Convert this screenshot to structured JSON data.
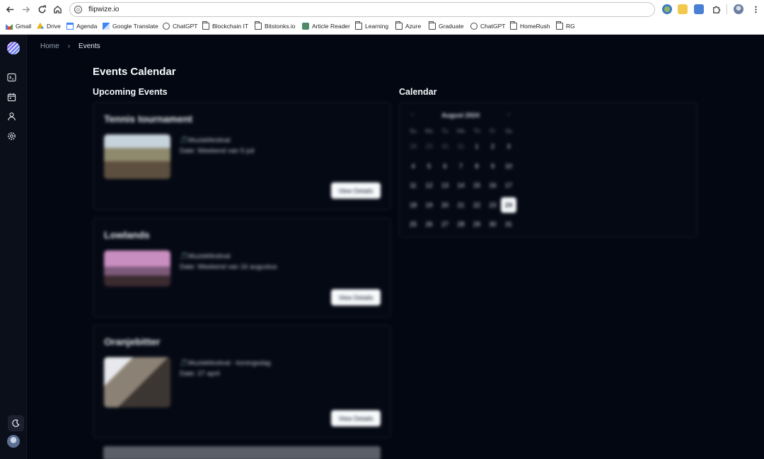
{
  "browser": {
    "url": "flipwize.io",
    "bookmarks": [
      {
        "label": "Gmail",
        "icon": "gmail-icon"
      },
      {
        "label": "Drive",
        "icon": "drive-icon"
      },
      {
        "label": "Agenda",
        "icon": "calendar-icon"
      },
      {
        "label": "Google Translate",
        "icon": "translate-icon"
      },
      {
        "label": "ChatGPT",
        "icon": "chatgpt-icon"
      },
      {
        "label": "Blockchain IT",
        "icon": "folder-icon"
      },
      {
        "label": "Bitstonks.io",
        "icon": "folder-icon"
      },
      {
        "label": "Article Reader",
        "icon": "article-reader-icon"
      },
      {
        "label": "Learning",
        "icon": "folder-icon"
      },
      {
        "label": "Azure",
        "icon": "folder-icon"
      },
      {
        "label": "Graduate",
        "icon": "folder-icon"
      },
      {
        "label": "ChatGPT",
        "icon": "chatgpt-icon"
      },
      {
        "label": "HomeRush",
        "icon": "folder-icon"
      },
      {
        "label": "RG",
        "icon": "folder-icon"
      }
    ]
  },
  "breadcrumb": {
    "home": "Home",
    "separator": "›",
    "current": "Events"
  },
  "page": {
    "title": "Events Calendar",
    "upcoming_title": "Upcoming Events",
    "calendar_title": "Calendar"
  },
  "events": [
    {
      "title": "Tennis tournament",
      "category": "🎵Muziekfestival",
      "date": "Date: Weekend van 5 juli",
      "button": "View Details"
    },
    {
      "title": "Lowlands",
      "category": "🎵Muziekfestival",
      "date": "Date: Weekend van 16 augustus",
      "button": "View Details"
    },
    {
      "title": "Oranjebitter",
      "category": "🎵Muziekfestival - koningsdag",
      "date": "Date: 27 april",
      "button": "View Details"
    }
  ],
  "calendar": {
    "month": "August 2024",
    "prev": "‹",
    "next": "›",
    "weekdays": [
      "Su",
      "Mo",
      "Tu",
      "We",
      "Th",
      "Fr",
      "Sa"
    ],
    "weeks": [
      [
        "28",
        "29",
        "30",
        "31",
        "1",
        "2",
        "3"
      ],
      [
        "4",
        "5",
        "6",
        "7",
        "8",
        "9",
        "10"
      ],
      [
        "11",
        "12",
        "13",
        "14",
        "15",
        "16",
        "17"
      ],
      [
        "18",
        "19",
        "20",
        "21",
        "22",
        "23",
        "24"
      ],
      [
        "25",
        "26",
        "27",
        "28",
        "29",
        "30",
        "31"
      ]
    ],
    "selected_day": "24",
    "muted_days_first_week": 4
  },
  "colors": {
    "app_background": "#030711",
    "sidebar_background": "#0b0f19",
    "button_background": "#f8fafc"
  }
}
